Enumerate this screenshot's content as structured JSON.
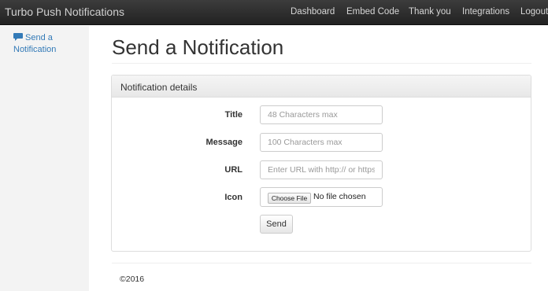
{
  "navbar": {
    "brand": "Turbo Push Notifications",
    "links": [
      {
        "label": "Dashboard"
      },
      {
        "label": "Embed Code"
      },
      {
        "label": "Thank you"
      },
      {
        "label": "Integrations"
      },
      {
        "label": "Logout"
      }
    ]
  },
  "sidebar": {
    "items": [
      {
        "label": "Send a Notification",
        "icon": "chat-bubble-icon",
        "color": "#337ab7"
      }
    ]
  },
  "main": {
    "title": "Send a Notification",
    "panel": {
      "heading": "Notification details",
      "fields": {
        "title": {
          "label": "Title",
          "placeholder": "48 Characters max",
          "value": ""
        },
        "message": {
          "label": "Message",
          "placeholder": "100 Characters max",
          "value": ""
        },
        "url": {
          "label": "URL",
          "placeholder": "Enter URL with http:// or https://",
          "value": ""
        },
        "icon": {
          "label": "Icon",
          "button_label": "Choose File",
          "status": "No file chosen"
        }
      },
      "submit_label": "Send"
    }
  },
  "footer": {
    "text": "©2016"
  }
}
